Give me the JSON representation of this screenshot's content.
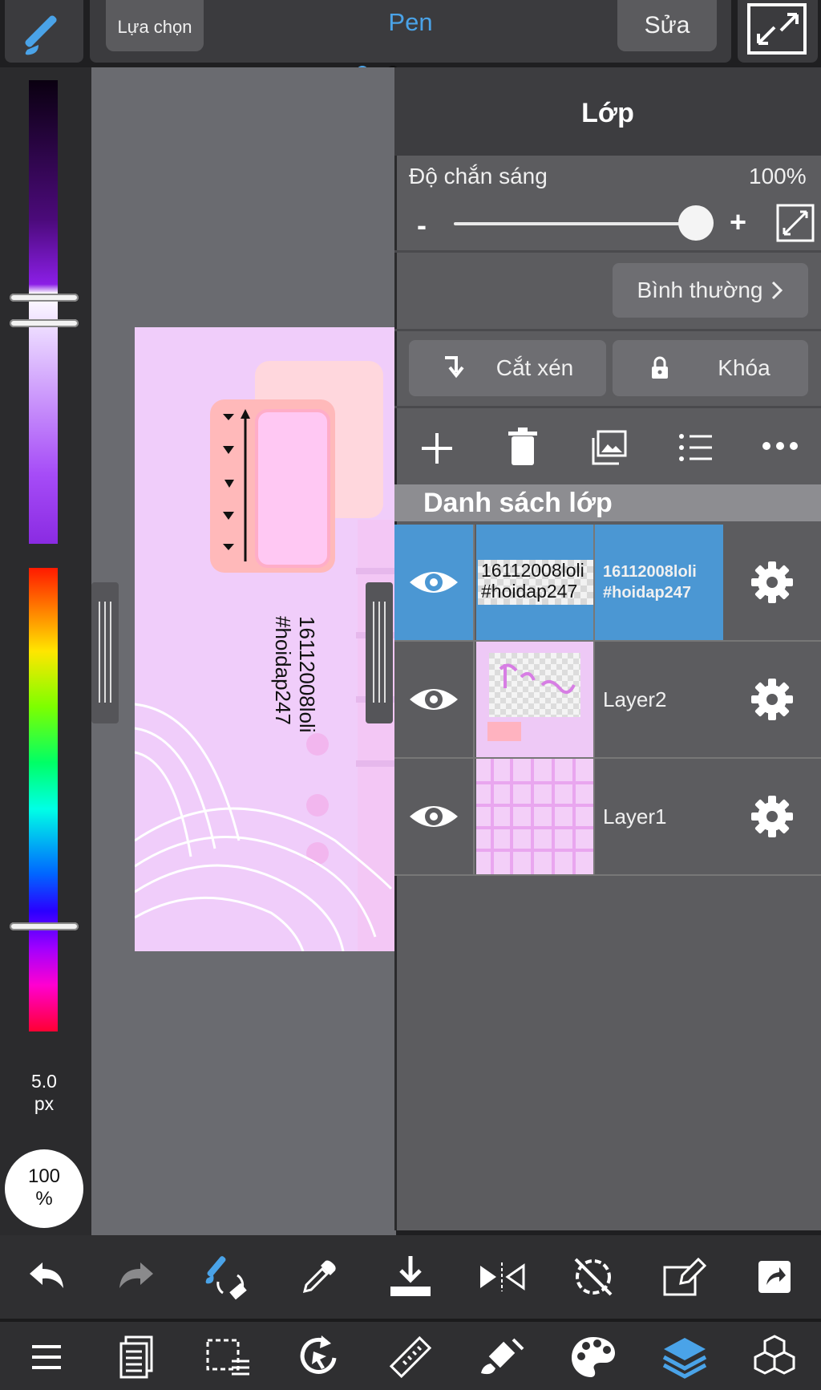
{
  "top": {
    "select_label": "Lựa chọn",
    "title": "Pen",
    "edit_label": "Sửa"
  },
  "left": {
    "brush_size": "5.0\npx",
    "opacity": "100\n%"
  },
  "artwork": {
    "line1": "16112008loli",
    "line2": "#hoidap247"
  },
  "panel": {
    "title": "Lớp",
    "opacity_label": "Độ chắn sáng",
    "opacity_value": "100%",
    "minus": "-",
    "plus": "+",
    "blend_mode": "Bình thường",
    "clip_label": "Cắt xén",
    "lock_label": "Khóa",
    "list_title": "Danh sách lớp"
  },
  "layers": [
    {
      "name": "16112008loli\n#hoidap247",
      "thumb_text": "16112008loli\n#hoidap247",
      "active": true
    },
    {
      "name": "Layer2",
      "active": false
    },
    {
      "name": "Layer1",
      "active": false
    }
  ],
  "colors": {
    "accent": "#4aa3e8",
    "active_layer": "#4b97d3",
    "canvas_pink": "#f0cdfa"
  }
}
